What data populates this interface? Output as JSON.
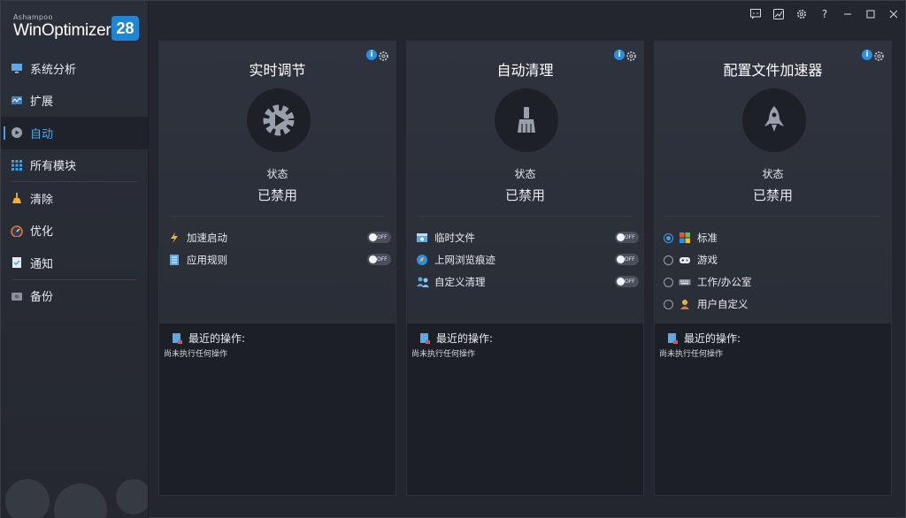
{
  "brand": {
    "small": "Ashampoo",
    "name": "WinOptimizer",
    "version": "28",
    "accent": "#1f86d6"
  },
  "sidebar": {
    "items": [
      {
        "label": "系统分析",
        "icon": "monitor-chart-icon"
      },
      {
        "label": "扩展",
        "icon": "pulse-icon"
      },
      {
        "label": "自动",
        "icon": "auto-play-icon",
        "active": true
      },
      {
        "label": "所有模块",
        "icon": "grid-icon"
      },
      {
        "label": "清除",
        "icon": "broom-icon"
      },
      {
        "label": "优化",
        "icon": "speedometer-icon"
      },
      {
        "label": "通知",
        "icon": "checklist-icon"
      },
      {
        "label": "备份",
        "icon": "backup-drive-icon"
      }
    ]
  },
  "titlebar": {
    "buttons": [
      "feedback-icon",
      "chart-icon",
      "settings-icon",
      "help-icon",
      "minimize-icon",
      "maximize-icon",
      "close-icon"
    ],
    "help": "?"
  },
  "cards": [
    {
      "title": "实时调节",
      "status_label": "状态",
      "status_value": "已禁用",
      "options": [
        {
          "label": "加速启动",
          "toggle": "OFF",
          "icon": "lightning-icon"
        },
        {
          "label": "应用规则",
          "toggle": "OFF",
          "icon": "rules-icon"
        }
      ],
      "recent_title": "最近的操作:",
      "recent_text": "尚未执行任何操作"
    },
    {
      "title": "自动清理",
      "status_label": "状态",
      "status_value": "已禁用",
      "options": [
        {
          "label": "临时文件",
          "toggle": "OFF",
          "icon": "temp-files-icon"
        },
        {
          "label": "上网浏览痕迹",
          "toggle": "OFF",
          "icon": "browser-icon"
        },
        {
          "label": "自定义清理",
          "toggle": "OFF",
          "icon": "users-icon"
        }
      ],
      "recent_title": "最近的操作:",
      "recent_text": "尚未执行任何操作"
    },
    {
      "title": "配置文件加速器",
      "status_label": "状态",
      "status_value": "已禁用",
      "options": [
        {
          "label": "标准",
          "selected": true,
          "icon": "windows-icon"
        },
        {
          "label": "游戏",
          "selected": false,
          "icon": "gamepad-icon"
        },
        {
          "label": "工作/办公室",
          "selected": false,
          "icon": "keyboard-icon"
        },
        {
          "label": "用户自定义",
          "selected": false,
          "icon": "user-icon"
        }
      ],
      "recent_title": "最近的操作:",
      "recent_text": "尚未执行任何操作"
    }
  ],
  "info_glyph": "i"
}
